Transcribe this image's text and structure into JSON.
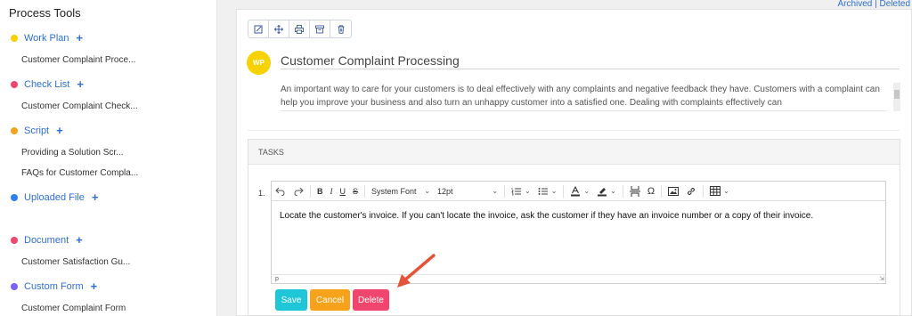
{
  "sidebar": {
    "title": "Process Tools",
    "categories": [
      {
        "label": "Work Plan",
        "color": "#f7d200",
        "items": [
          "Customer Complaint Proce..."
        ]
      },
      {
        "label": "Check List",
        "color": "#f0466e",
        "items": [
          "Customer Complaint Check..."
        ]
      },
      {
        "label": "Script",
        "color": "#f6a21a",
        "items": [
          "Providing a Solution Scr...",
          "FAQs for Customer Compla..."
        ]
      },
      {
        "label": "Uploaded File",
        "color": "#2f80ed",
        "items": []
      },
      {
        "label": "Document",
        "color": "#f0466e",
        "items": [
          "Customer Satisfaction Gu..."
        ]
      },
      {
        "label": "Custom Form",
        "color": "#7b61ff",
        "items": [
          "Customer Complaint Form"
        ]
      }
    ],
    "plus": "+"
  },
  "top_links": {
    "archived": "Archived",
    "divider": "|",
    "deleted": "Deleted"
  },
  "doc": {
    "avatar": "WP",
    "title": "Customer Complaint Processing",
    "description": "An important way to care for your customers is to deal effectively with any complaints and negative feedback they have. Customers with a complaint can help you improve your business and also turn an unhappy customer into a satisfied one. Dealing with complaints effectively can"
  },
  "tasks": {
    "header": "TASKS",
    "item_number": "1.",
    "editor": {
      "font_family": "System Font",
      "font_size": "12pt",
      "content": "Locate the customer's invoice. If you can't locate the invoice, ask the customer if they have an invoice number or a copy of their invoice.",
      "status_path": "p"
    },
    "buttons": {
      "save": "Save",
      "cancel": "Cancel",
      "delete": "Delete"
    }
  },
  "colors": {
    "accent": "#2f6fd0",
    "save": "#1ec6d8",
    "cancel": "#f6a21a",
    "delete": "#f0466e",
    "arrow": "#e4543a"
  }
}
